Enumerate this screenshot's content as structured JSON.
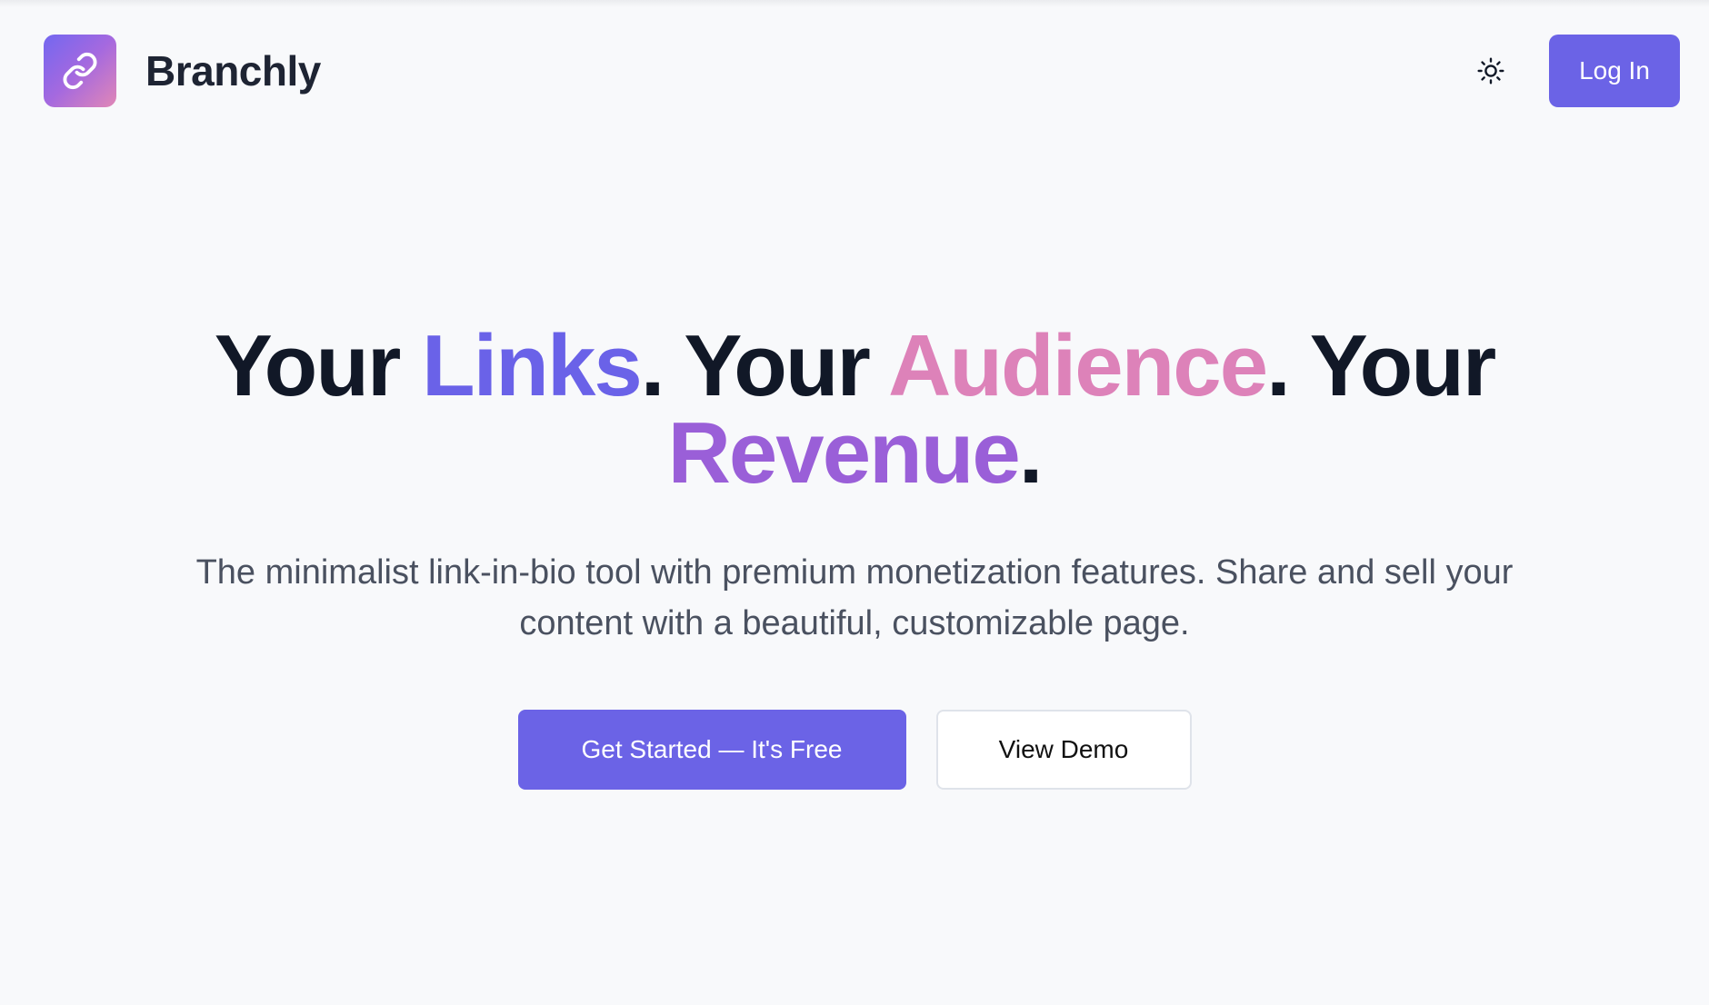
{
  "header": {
    "brand_name": "Branchly",
    "logo_icon": "link-icon",
    "theme_toggle_icon": "sun-icon",
    "login_label": "Log In"
  },
  "hero": {
    "title_parts": [
      "Your",
      "Links",
      ". Your",
      "Audience",
      ". Your",
      "Revenue",
      "."
    ],
    "subtitle": "The minimalist link-in-bio tool with premium monetization features. Share and sell your content with a beautiful, customizable page."
  },
  "actions": {
    "primary_label": "Get Started — It's Free",
    "secondary_label": "View Demo"
  },
  "colors": {
    "accent": "#6b63e6",
    "links": "#6a62e8",
    "audience": "#dd82b9",
    "revenue": "#9a5fd8",
    "background": "#f8f9fb"
  }
}
